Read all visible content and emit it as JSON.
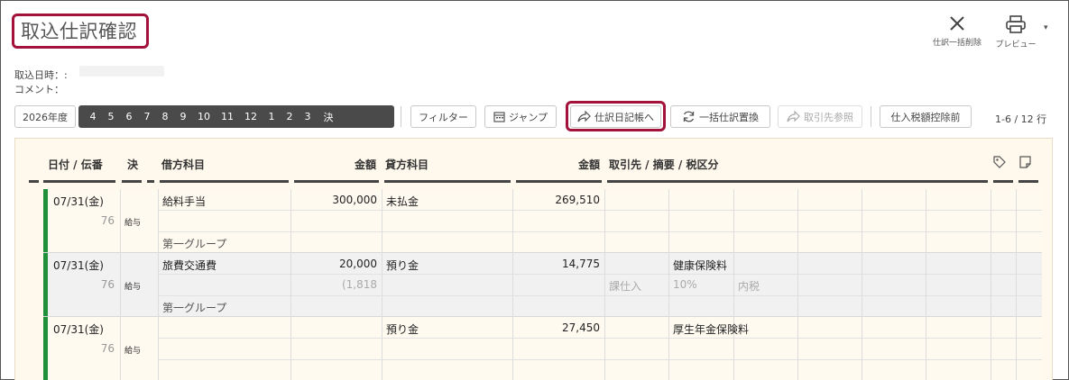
{
  "title": "取込仕訳確認",
  "actions": {
    "delete_all": "仕訳一括削除",
    "preview": "プレビュー"
  },
  "meta": {
    "import_date_label": "取込日時：:",
    "comment_label": "コメント："
  },
  "toolbar": {
    "year": "2026年度",
    "months": [
      "4",
      "5",
      "6",
      "7",
      "8",
      "9",
      "10",
      "11",
      "12",
      "1",
      "2",
      "3",
      "決"
    ],
    "filter": "フィルター",
    "jump": "ジャンプ",
    "to_journal": "仕訳日記帳へ",
    "bulk_replace": "一括仕訳置換",
    "partner_ref": "取引先参照",
    "tax_mode": "仕入税額控除前",
    "count": "1-6 / 12 行"
  },
  "columns": {
    "date": "日付 / 伝番",
    "settle": "決",
    "debit_account": "借方科目",
    "debit_amount": "金額",
    "credit_account": "貸方科目",
    "credit_amount": "金額",
    "partner": "取引先 / 摘要 / 税区分"
  },
  "rows": [
    {
      "date": "07/31(金)",
      "no": "76",
      "tag": "給与",
      "debit_account": "給料手当",
      "debit_amount": "300,000",
      "credit_account": "未払金",
      "credit_amount": "269,510",
      "summary": "",
      "tax_class": "",
      "tax_rate": "",
      "tax_incl": "",
      "tax_amount": "",
      "group": "第一グループ"
    },
    {
      "date": "07/31(金)",
      "no": "76",
      "tag": "給与",
      "debit_account": "旅費交通費",
      "debit_amount": "20,000",
      "credit_account": "預り金",
      "credit_amount": "14,775",
      "summary": "健康保険料",
      "tax_class": "課仕入",
      "tax_rate": "10%",
      "tax_incl": "内税",
      "tax_amount": "(1,818",
      "group": "第一グループ"
    },
    {
      "date": "07/31(金)",
      "no": "76",
      "tag": "給与",
      "debit_account": "",
      "debit_amount": "",
      "credit_account": "預り金",
      "credit_amount": "27,450",
      "summary": "厚生年金保険料",
      "tax_class": "",
      "tax_rate": "",
      "tax_incl": "",
      "tax_amount": "",
      "group": ""
    }
  ]
}
